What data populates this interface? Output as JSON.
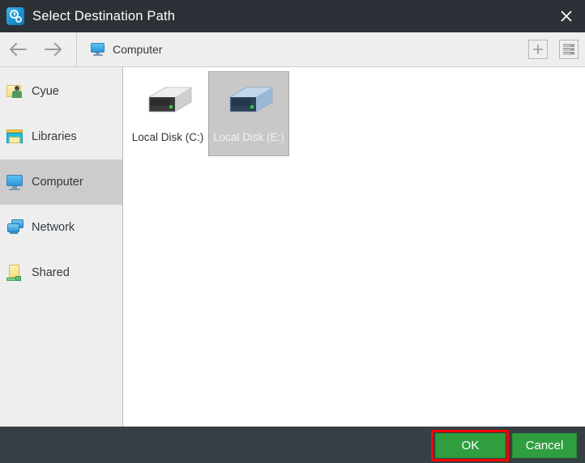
{
  "window": {
    "title": "Select Destination Path",
    "app_icon": "clock-gear-icon",
    "close_icon": "close-icon",
    "titlebar_color": "#2b3136",
    "footer_color": "#363f43"
  },
  "toolbar": {
    "back_icon": "arrow-left-icon",
    "forward_icon": "arrow-right-icon",
    "breadcrumb": {
      "icon": "monitor-icon",
      "label": "Computer"
    },
    "actions": [
      {
        "name": "new-folder-button",
        "icon": "plus-box-icon"
      },
      {
        "name": "view-mode-button",
        "icon": "list-view-icon"
      }
    ]
  },
  "sidebar": {
    "items": [
      {
        "label": "Cyue",
        "icon": "user-folder-icon",
        "selected": false
      },
      {
        "label": "Libraries",
        "icon": "libraries-icon",
        "selected": false
      },
      {
        "label": "Computer",
        "icon": "monitor-icon",
        "selected": true
      },
      {
        "label": "Network",
        "icon": "network-icon",
        "selected": false
      },
      {
        "label": "Shared",
        "icon": "shared-folder-icon",
        "selected": false
      }
    ],
    "selected_bg": "#cccccc"
  },
  "main": {
    "items": [
      {
        "label": "Local Disk (C:)",
        "icon": "hard-drive-icon",
        "selected": false
      },
      {
        "label": "Local Disk (E:)",
        "icon": "hard-drive-icon",
        "selected": true
      }
    ]
  },
  "footer": {
    "ok_label": "OK",
    "cancel_label": "Cancel",
    "button_color": "#2f9e3f",
    "highlight_color": "#ff0000"
  }
}
